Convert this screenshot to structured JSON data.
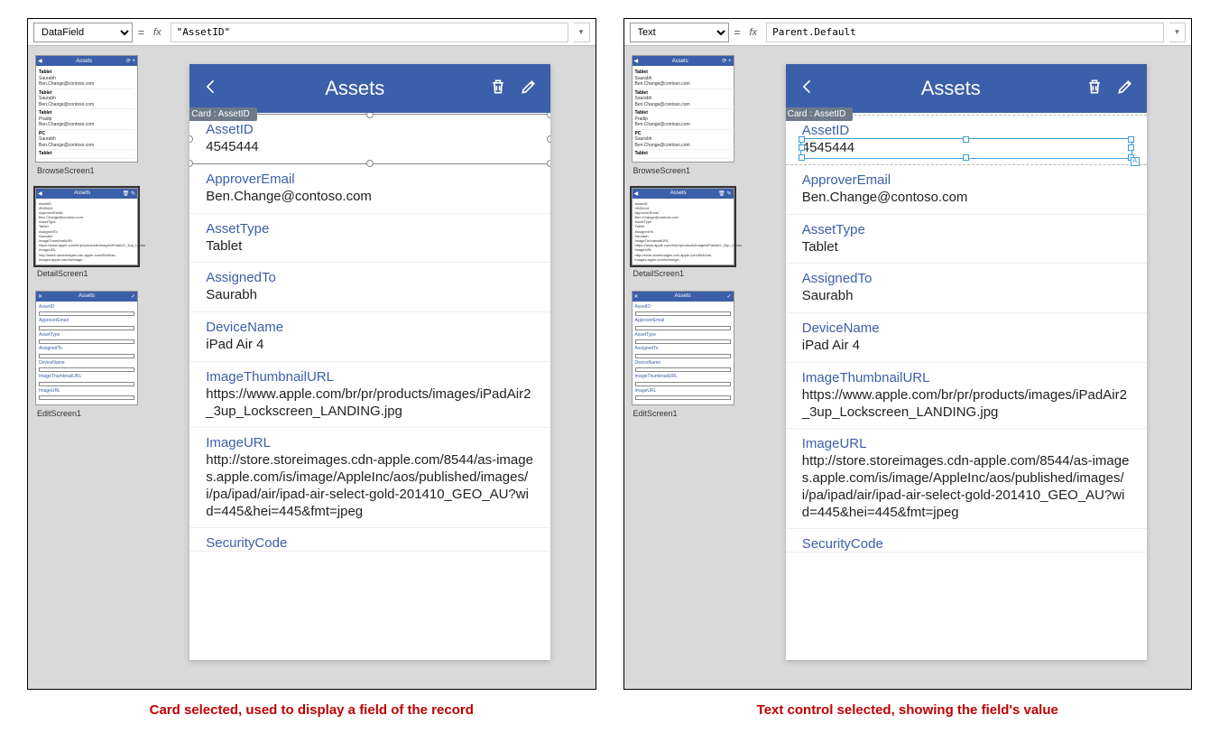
{
  "left": {
    "propSelect": "DataField",
    "formula": "\"AssetID\"",
    "badge": "Card : AssetID",
    "caption": "Card selected, used to display a field of the record"
  },
  "right": {
    "propSelect": "Text",
    "formula": "Parent.Default",
    "badge": "Card : AssetID",
    "caption": "Text control selected, showing the field's value"
  },
  "thumbs": {
    "browse": "BrowseScreen1",
    "detail": "DetailScreen1",
    "edit": "EditScreen1"
  },
  "device": {
    "title": "Assets",
    "fields": [
      {
        "label": "AssetID",
        "value": "4545444"
      },
      {
        "label": "ApproverEmail",
        "value": "Ben.Change@contoso.com"
      },
      {
        "label": "AssetType",
        "value": "Tablet"
      },
      {
        "label": "AssignedTo",
        "value": "Saurabh"
      },
      {
        "label": "DeviceName",
        "value": "iPad Air 4"
      },
      {
        "label": "ImageThumbnailURL",
        "value": "https://www.apple.com/br/pr/products/images/iPadAir2_3up_Lockscreen_LANDING.jpg"
      },
      {
        "label": "ImageURL",
        "value": "http://store.storeimages.cdn-apple.com/8544/as-images.apple.com/is/image/AppleInc/aos/published/images/i/pa/ipad/air/ipad-air-select-gold-201410_GEO_AU?wid=445&hei=445&fmt=jpeg"
      },
      {
        "label": "SecurityCode",
        "value": ""
      }
    ]
  }
}
